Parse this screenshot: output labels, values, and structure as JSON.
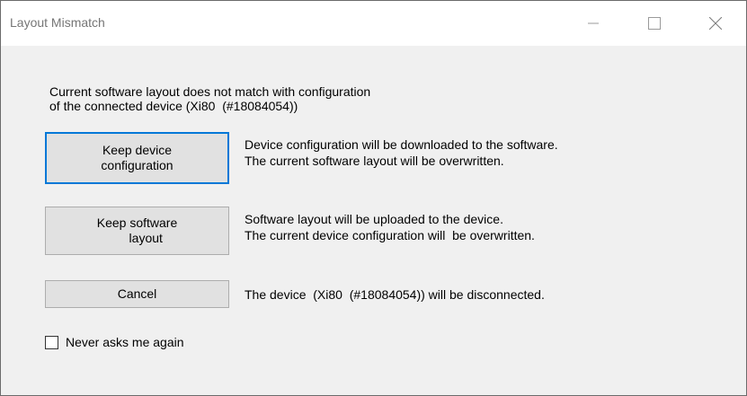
{
  "window": {
    "title": "Layout Mismatch",
    "controls": {
      "minimize_icon": "minimize-icon",
      "maximize_icon": "maximize-icon",
      "close_icon": "close-icon"
    }
  },
  "message": "Current software layout does not match with configuration\nof the connected device (Xi80  (#18084054))",
  "options": [
    {
      "button_label": "Keep device\nconfiguration",
      "description": "Device configuration will be downloaded to the software.\nThe current software layout will be overwritten."
    },
    {
      "button_label": "Keep software\n     layout",
      "description": "Software layout will be uploaded to the device.\nThe current device configuration will  be overwritten."
    },
    {
      "button_label": "Cancel",
      "description": "The device  (Xi80  (#18084054)) will be disconnected."
    }
  ],
  "never_ask": {
    "label": "Never asks me again",
    "checked": false
  },
  "colors": {
    "focus_border": "#0078d7",
    "button_face": "#e1e1e1",
    "dialog_background": "#f0f0f0"
  }
}
